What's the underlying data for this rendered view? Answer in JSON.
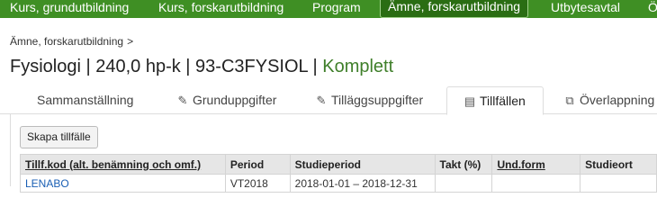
{
  "topnav": {
    "items": [
      {
        "label": "Kurs, grundutbildning"
      },
      {
        "label": "Kurs, forskarutbildning"
      },
      {
        "label": "Program"
      },
      {
        "label": "Ämne, forskarutbildning"
      },
      {
        "label": "Utbytesavtal"
      },
      {
        "label": "Ö"
      }
    ]
  },
  "breadcrumb": {
    "label": "Ämne, forskarutbildning",
    "separator": ">"
  },
  "title": {
    "main": "Fysiologi | 240,0 hp-k | 93-C3FYSIOL |",
    "status": "Komplett"
  },
  "tabs": [
    {
      "label": "Sammanställning",
      "icon": ""
    },
    {
      "label": "Grunduppgifter",
      "icon": "pencil-icon"
    },
    {
      "label": "Tilläggsuppgifter",
      "icon": "pencil-icon"
    },
    {
      "label": "Tillfällen",
      "icon": "calendar-icon"
    },
    {
      "label": "Överlappning",
      "icon": "copy-icon"
    }
  ],
  "create_button": "Skapa tillfälle",
  "table": {
    "headers": [
      "Tillf.kod (alt. benämning och omf.)",
      "Period",
      "Studieperiod",
      "Takt (%)",
      "Und.form",
      "Studieort"
    ],
    "rows": [
      [
        "LENABO",
        "VT2018",
        "2018-01-01 – 2018-12-31",
        "",
        "",
        ""
      ]
    ]
  },
  "colors": {
    "nav_bg": "#3f8f24",
    "nav_active": "#2a6d13",
    "status_green": "#3f7f2a",
    "link": "#1a5fb4"
  }
}
